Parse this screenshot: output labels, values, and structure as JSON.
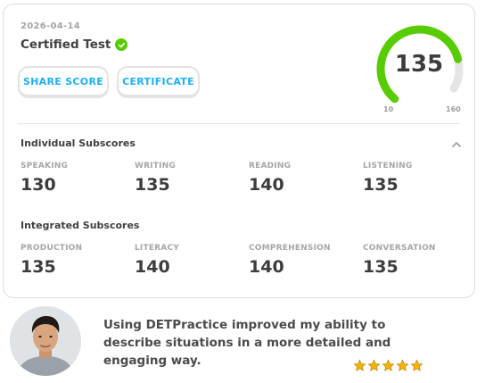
{
  "report": {
    "date": "2026-04-14",
    "title": "Certified Test",
    "share_label": "SHARE SCORE",
    "certificate_label": "CERTIFICATE"
  },
  "gauge": {
    "score": "135",
    "min": "10",
    "max": "160",
    "fill_fraction": 0.83,
    "fill_color": "#58cc02",
    "track_color": "#e5e5e5"
  },
  "individual": {
    "title": "Individual Subscores",
    "items": [
      {
        "label": "SPEAKING",
        "value": "130"
      },
      {
        "label": "WRITING",
        "value": "135"
      },
      {
        "label": "READING",
        "value": "140"
      },
      {
        "label": "LISTENING",
        "value": "135"
      }
    ]
  },
  "integrated": {
    "title": "Integrated Subscores",
    "items": [
      {
        "label": "PRODUCTION",
        "value": "135"
      },
      {
        "label": "LITERACY",
        "value": "140"
      },
      {
        "label": "COMPREHENSION",
        "value": "140"
      },
      {
        "label": "CONVERSATION",
        "value": "135"
      }
    ]
  },
  "testimonial": {
    "text": "Using DETPractice improved my ability to describe situations in a more detailed and engaging way.",
    "rating": 5
  },
  "colors": {
    "accent_blue": "#1cb0f6",
    "success_green": "#58cc02",
    "star_gold": "#f5b301"
  }
}
